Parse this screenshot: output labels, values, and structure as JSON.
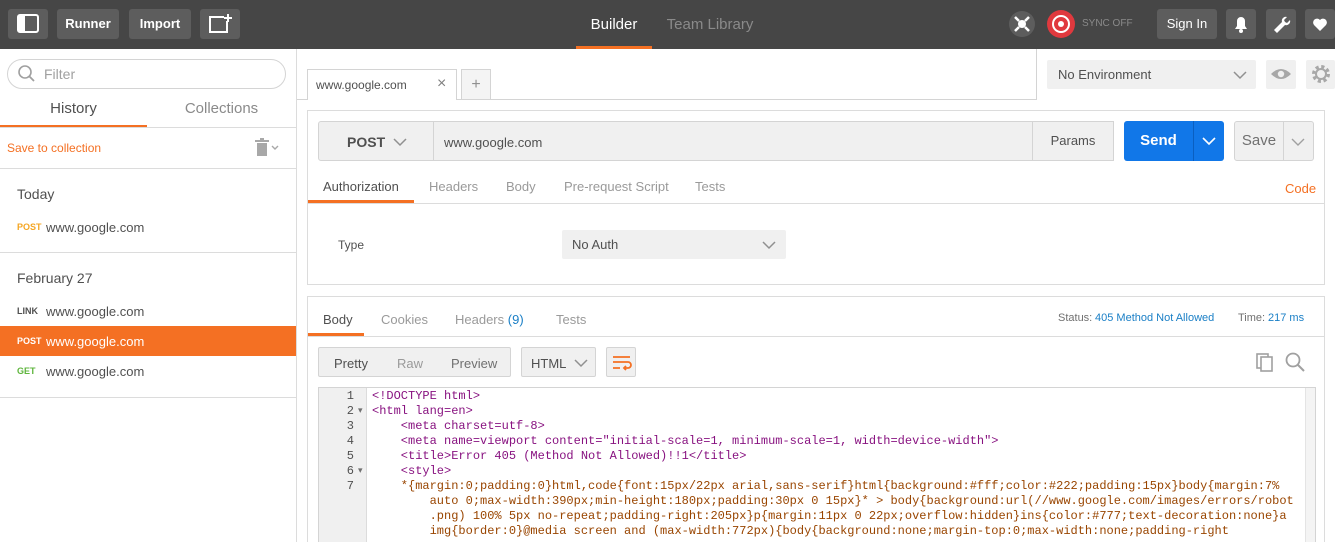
{
  "topbar": {
    "runner_label": "Runner",
    "import_label": "Import",
    "tabs": [
      {
        "label": "Builder",
        "active": true
      },
      {
        "label": "Team Library",
        "active": false
      }
    ],
    "sync_label": "SYNC OFF",
    "signin_label": "Sign In"
  },
  "sidebar": {
    "filter_placeholder": "Filter",
    "tabs": [
      "History",
      "Collections"
    ],
    "save_to_collection": "Save to collection",
    "groups": [
      {
        "label": "Today",
        "items": [
          {
            "method": "POST",
            "url": "www.google.com",
            "selected": false
          }
        ]
      },
      {
        "label": "February 27",
        "items": [
          {
            "method": "LINK",
            "url": "www.google.com",
            "selected": false
          },
          {
            "method": "POST",
            "url": "www.google.com",
            "selected": true
          },
          {
            "method": "GET",
            "url": "www.google.com",
            "selected": false
          }
        ]
      }
    ]
  },
  "request_tab": {
    "label": "www.google.com"
  },
  "environment": {
    "selected": "No Environment"
  },
  "request": {
    "method": "POST",
    "url": "www.google.com",
    "params_label": "Params",
    "send_label": "Send",
    "save_label": "Save",
    "tabs": [
      "Authorization",
      "Headers",
      "Body",
      "Pre-request Script",
      "Tests"
    ],
    "active_tab": "Authorization",
    "code_link": "Code",
    "auth": {
      "type_label": "Type",
      "type_value": "No Auth"
    }
  },
  "response": {
    "tabs": {
      "body": "Body",
      "cookies": "Cookies",
      "headers": "Headers",
      "headers_count": "(9)",
      "tests": "Tests"
    },
    "status_label": "Status:",
    "status_value": "405 Method Not Allowed",
    "time_label": "Time:",
    "time_value": "217 ms",
    "view_modes": [
      "Pretty",
      "Raw",
      "Preview"
    ],
    "format": "HTML",
    "code_lines": [
      {
        "n": "1",
        "fold": false,
        "text": "<!DOCTYPE html>"
      },
      {
        "n": "2",
        "fold": true,
        "text": "<html lang=en>"
      },
      {
        "n": "3",
        "fold": false,
        "text": "    <meta charset=utf-8>"
      },
      {
        "n": "4",
        "fold": false,
        "text": "    <meta name=viewport content=\"initial-scale=1, minimum-scale=1, width=device-width\">"
      },
      {
        "n": "5",
        "fold": false,
        "text": "    <title>Error 405 (Method Not Allowed)!!1</title>"
      },
      {
        "n": "6",
        "fold": true,
        "text": "    <style>"
      },
      {
        "n": "7",
        "fold": false,
        "text": "    *{margin:0;padding:0}html,code{font:15px/22px arial,sans-serif}html{background:#fff;color:#222;padding:15px}body{margin:7%"
      },
      {
        "n": "",
        "fold": false,
        "text": "        auto 0;max-width:390px;min-height:180px;padding:30px 0 15px}* > body{background:url(//www.google.com/images/errors/robot"
      },
      {
        "n": "",
        "fold": false,
        "text": "        .png) 100% 5px no-repeat;padding-right:205px}p{margin:11px 0 22px;overflow:hidden}ins{color:#777;text-decoration:none}a"
      },
      {
        "n": "",
        "fold": false,
        "text": "        img{border:0}@media screen and (max-width:772px){body{background:none;margin-top:0;max-width:none;padding-right"
      }
    ]
  },
  "colors": {
    "accent": "#f47023",
    "send": "#1177e8",
    "topbar": "#464646",
    "status": "#1a7fc6"
  }
}
